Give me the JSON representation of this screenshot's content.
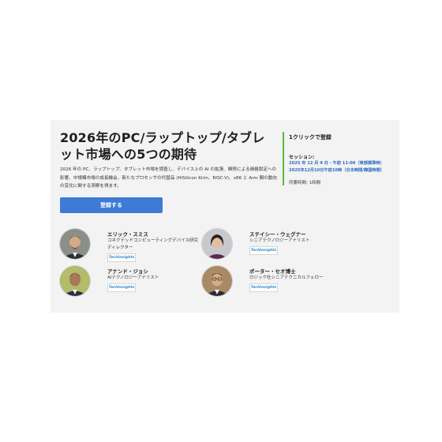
{
  "event": {
    "title": "2026年のPC/ラップトップ/タブレット市場への5つの期待",
    "description": "2026 年の PC、ラップトップ、タブレット市場を調査し、デバイス上の AI の拡張、関税による価格設定への影響、中規模市場の成長機会、新たなプロセッサの代替品 (HiSilicon Kirin、RISC-V)、x86 と Arm 間の動向の変化に関する洞察を得ます。",
    "register_button": "登録する"
  },
  "sidebar": {
    "heading": "1クリックで登録",
    "session_label": "セッション:",
    "session_time_1": "2025 年 12 月 9 日 - 午前 11:00（東部標準時）",
    "session_time_2": "2025年12月10日午前10時（日本時間/韓国時間）",
    "duration": "所要時間: 1時間"
  },
  "speakers": [
    {
      "name": "エリック・スミス",
      "role": "コネクテッドコンピューティングデバイス研究ディレクター",
      "badge": "TechInsights"
    },
    {
      "name": "ステイシー・ウェグナー",
      "role": "シニアテクノロジーアナリスト",
      "badge": "TechInsights"
    },
    {
      "name": "アナンド・ジョシ",
      "role": "AIテクノロジーアナリスト",
      "badge": "TechInsights"
    },
    {
      "name": "ポーター・セオ博士",
      "role": "ロジック社シニアテクニカルフェロー",
      "badge": "TechInsights"
    }
  ],
  "colors": {
    "accent_blue": "#3d7bd4",
    "link_blue": "#2d6bc4",
    "green_bar": "#5fb837",
    "card_bg": "#f3f3f3"
  }
}
